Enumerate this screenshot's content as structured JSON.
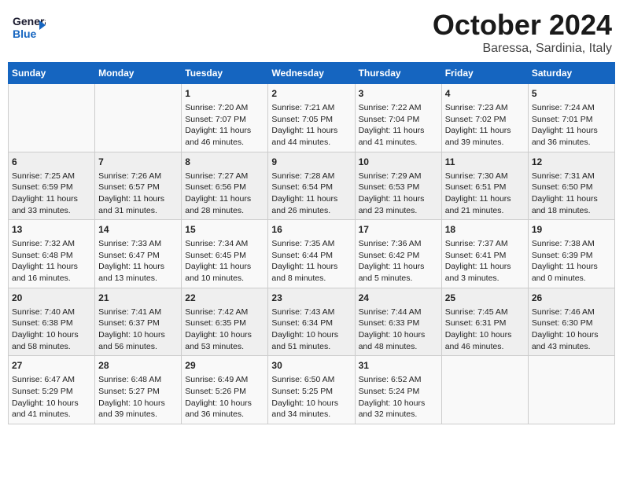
{
  "header": {
    "logo_line1": "General",
    "logo_line2": "Blue",
    "month_title": "October 2024",
    "location": "Baressa, Sardinia, Italy"
  },
  "days_of_week": [
    "Sunday",
    "Monday",
    "Tuesday",
    "Wednesday",
    "Thursday",
    "Friday",
    "Saturday"
  ],
  "weeks": [
    [
      {
        "day": "",
        "sunrise": "",
        "sunset": "",
        "daylight": ""
      },
      {
        "day": "",
        "sunrise": "",
        "sunset": "",
        "daylight": ""
      },
      {
        "day": "1",
        "sunrise": "Sunrise: 7:20 AM",
        "sunset": "Sunset: 7:07 PM",
        "daylight": "Daylight: 11 hours and 46 minutes."
      },
      {
        "day": "2",
        "sunrise": "Sunrise: 7:21 AM",
        "sunset": "Sunset: 7:05 PM",
        "daylight": "Daylight: 11 hours and 44 minutes."
      },
      {
        "day": "3",
        "sunrise": "Sunrise: 7:22 AM",
        "sunset": "Sunset: 7:04 PM",
        "daylight": "Daylight: 11 hours and 41 minutes."
      },
      {
        "day": "4",
        "sunrise": "Sunrise: 7:23 AM",
        "sunset": "Sunset: 7:02 PM",
        "daylight": "Daylight: 11 hours and 39 minutes."
      },
      {
        "day": "5",
        "sunrise": "Sunrise: 7:24 AM",
        "sunset": "Sunset: 7:01 PM",
        "daylight": "Daylight: 11 hours and 36 minutes."
      }
    ],
    [
      {
        "day": "6",
        "sunrise": "Sunrise: 7:25 AM",
        "sunset": "Sunset: 6:59 PM",
        "daylight": "Daylight: 11 hours and 33 minutes."
      },
      {
        "day": "7",
        "sunrise": "Sunrise: 7:26 AM",
        "sunset": "Sunset: 6:57 PM",
        "daylight": "Daylight: 11 hours and 31 minutes."
      },
      {
        "day": "8",
        "sunrise": "Sunrise: 7:27 AM",
        "sunset": "Sunset: 6:56 PM",
        "daylight": "Daylight: 11 hours and 28 minutes."
      },
      {
        "day": "9",
        "sunrise": "Sunrise: 7:28 AM",
        "sunset": "Sunset: 6:54 PM",
        "daylight": "Daylight: 11 hours and 26 minutes."
      },
      {
        "day": "10",
        "sunrise": "Sunrise: 7:29 AM",
        "sunset": "Sunset: 6:53 PM",
        "daylight": "Daylight: 11 hours and 23 minutes."
      },
      {
        "day": "11",
        "sunrise": "Sunrise: 7:30 AM",
        "sunset": "Sunset: 6:51 PM",
        "daylight": "Daylight: 11 hours and 21 minutes."
      },
      {
        "day": "12",
        "sunrise": "Sunrise: 7:31 AM",
        "sunset": "Sunset: 6:50 PM",
        "daylight": "Daylight: 11 hours and 18 minutes."
      }
    ],
    [
      {
        "day": "13",
        "sunrise": "Sunrise: 7:32 AM",
        "sunset": "Sunset: 6:48 PM",
        "daylight": "Daylight: 11 hours and 16 minutes."
      },
      {
        "day": "14",
        "sunrise": "Sunrise: 7:33 AM",
        "sunset": "Sunset: 6:47 PM",
        "daylight": "Daylight: 11 hours and 13 minutes."
      },
      {
        "day": "15",
        "sunrise": "Sunrise: 7:34 AM",
        "sunset": "Sunset: 6:45 PM",
        "daylight": "Daylight: 11 hours and 10 minutes."
      },
      {
        "day": "16",
        "sunrise": "Sunrise: 7:35 AM",
        "sunset": "Sunset: 6:44 PM",
        "daylight": "Daylight: 11 hours and 8 minutes."
      },
      {
        "day": "17",
        "sunrise": "Sunrise: 7:36 AM",
        "sunset": "Sunset: 6:42 PM",
        "daylight": "Daylight: 11 hours and 5 minutes."
      },
      {
        "day": "18",
        "sunrise": "Sunrise: 7:37 AM",
        "sunset": "Sunset: 6:41 PM",
        "daylight": "Daylight: 11 hours and 3 minutes."
      },
      {
        "day": "19",
        "sunrise": "Sunrise: 7:38 AM",
        "sunset": "Sunset: 6:39 PM",
        "daylight": "Daylight: 11 hours and 0 minutes."
      }
    ],
    [
      {
        "day": "20",
        "sunrise": "Sunrise: 7:40 AM",
        "sunset": "Sunset: 6:38 PM",
        "daylight": "Daylight: 10 hours and 58 minutes."
      },
      {
        "day": "21",
        "sunrise": "Sunrise: 7:41 AM",
        "sunset": "Sunset: 6:37 PM",
        "daylight": "Daylight: 10 hours and 56 minutes."
      },
      {
        "day": "22",
        "sunrise": "Sunrise: 7:42 AM",
        "sunset": "Sunset: 6:35 PM",
        "daylight": "Daylight: 10 hours and 53 minutes."
      },
      {
        "day": "23",
        "sunrise": "Sunrise: 7:43 AM",
        "sunset": "Sunset: 6:34 PM",
        "daylight": "Daylight: 10 hours and 51 minutes."
      },
      {
        "day": "24",
        "sunrise": "Sunrise: 7:44 AM",
        "sunset": "Sunset: 6:33 PM",
        "daylight": "Daylight: 10 hours and 48 minutes."
      },
      {
        "day": "25",
        "sunrise": "Sunrise: 7:45 AM",
        "sunset": "Sunset: 6:31 PM",
        "daylight": "Daylight: 10 hours and 46 minutes."
      },
      {
        "day": "26",
        "sunrise": "Sunrise: 7:46 AM",
        "sunset": "Sunset: 6:30 PM",
        "daylight": "Daylight: 10 hours and 43 minutes."
      }
    ],
    [
      {
        "day": "27",
        "sunrise": "Sunrise: 6:47 AM",
        "sunset": "Sunset: 5:29 PM",
        "daylight": "Daylight: 10 hours and 41 minutes."
      },
      {
        "day": "28",
        "sunrise": "Sunrise: 6:48 AM",
        "sunset": "Sunset: 5:27 PM",
        "daylight": "Daylight: 10 hours and 39 minutes."
      },
      {
        "day": "29",
        "sunrise": "Sunrise: 6:49 AM",
        "sunset": "Sunset: 5:26 PM",
        "daylight": "Daylight: 10 hours and 36 minutes."
      },
      {
        "day": "30",
        "sunrise": "Sunrise: 6:50 AM",
        "sunset": "Sunset: 5:25 PM",
        "daylight": "Daylight: 10 hours and 34 minutes."
      },
      {
        "day": "31",
        "sunrise": "Sunrise: 6:52 AM",
        "sunset": "Sunset: 5:24 PM",
        "daylight": "Daylight: 10 hours and 32 minutes."
      },
      {
        "day": "",
        "sunrise": "",
        "sunset": "",
        "daylight": ""
      },
      {
        "day": "",
        "sunrise": "",
        "sunset": "",
        "daylight": ""
      }
    ]
  ]
}
